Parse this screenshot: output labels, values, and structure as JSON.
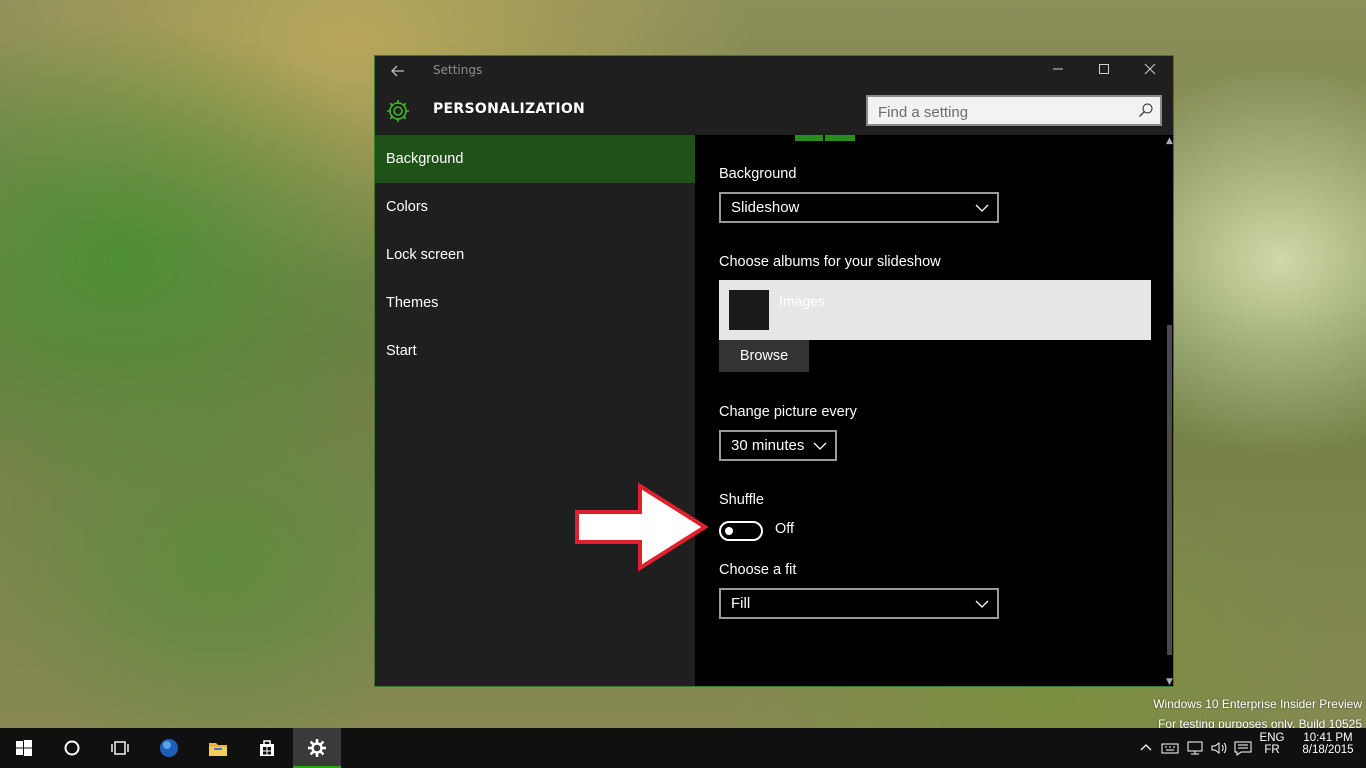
{
  "window": {
    "title": "Settings",
    "header_title": "PERSONALIZATION",
    "controls": [
      "minimize-icon",
      "maximize-icon",
      "close-icon"
    ],
    "accent_color": "#1e5216"
  },
  "search": {
    "placeholder": "Find a setting",
    "value": ""
  },
  "sidebar": {
    "items": [
      {
        "label": "Background",
        "selected": true
      },
      {
        "label": "Colors",
        "selected": false
      },
      {
        "label": "Lock screen",
        "selected": false
      },
      {
        "label": "Themes",
        "selected": false
      },
      {
        "label": "Start",
        "selected": false
      }
    ]
  },
  "content": {
    "background_label": "Background",
    "background_value": "Slideshow",
    "albums_label": "Choose albums for your slideshow",
    "album_name": "Images",
    "browse_label": "Browse",
    "interval_label": "Change picture every",
    "interval_value": "30 minutes",
    "shuffle_label": "Shuffle",
    "shuffle_state": "Off",
    "shuffle_on": false,
    "fit_label": "Choose a fit",
    "fit_value": "Fill"
  },
  "watermark": {
    "line1": "Windows 10 Enterprise Insider Preview",
    "line2": "For testing purposes only. Build 10525"
  },
  "taskbar": {
    "apps": [
      "start-icon",
      "cortana-icon",
      "task-view-icon",
      "edge-icon",
      "file-explorer-icon",
      "store-icon",
      "settings-icon"
    ],
    "active_app": "settings-icon",
    "tray": {
      "lang_top": "ENG",
      "lang_bottom": "FR",
      "time": "10:41 PM",
      "date": "8/18/2015"
    }
  }
}
